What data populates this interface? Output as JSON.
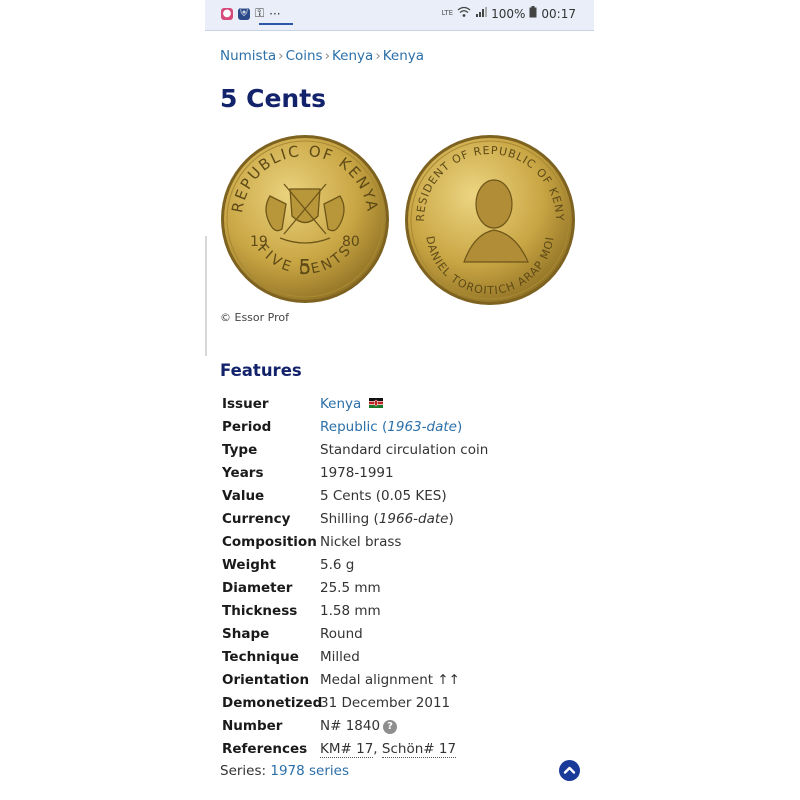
{
  "status_bar": {
    "time": "00:17",
    "battery": "100%",
    "network_label": "LTE",
    "more": "···"
  },
  "breadcrumb": [
    "Numista",
    "Coins",
    "Kenya",
    "Kenya"
  ],
  "breadcrumb_sep": "›",
  "title": "5 Cents",
  "image_credit": "© Essor Prof",
  "coin_obverse": {
    "legend_top": "REPUBLIC OF KENYA",
    "year_left": "19",
    "year_right": "80",
    "value": "5",
    "legend_bottom": "FIVE CENTS"
  },
  "coin_reverse": {
    "legend_top": "PRESIDENT OF REPUBLIC OF KENYA",
    "legend_bottom": "DANIEL TOROITICH ARAP MOI"
  },
  "features_heading": "Features",
  "features": {
    "issuer": {
      "label": "Issuer",
      "value": "Kenya"
    },
    "period": {
      "label": "Period",
      "value": "Republic",
      "paren_open": " (",
      "range": "1963-date",
      "paren_close": ")"
    },
    "type": {
      "label": "Type",
      "value": "Standard circulation coin"
    },
    "years": {
      "label": "Years",
      "value": "1978-1991"
    },
    "value": {
      "label": "Value",
      "value": "5 Cents (0.05 KES)"
    },
    "currency": {
      "label": "Currency",
      "value": "Shilling (",
      "range": "1966-date",
      "paren_close": ")"
    },
    "composition": {
      "label": "Composition",
      "value": "Nickel brass"
    },
    "weight": {
      "label": "Weight",
      "value": "5.6 g"
    },
    "diameter": {
      "label": "Diameter",
      "value": "25.5 mm"
    },
    "thickness": {
      "label": "Thickness",
      "value": "1.58 mm"
    },
    "shape": {
      "label": "Shape",
      "value": "Round"
    },
    "technique": {
      "label": "Technique",
      "value": "Milled"
    },
    "orientation": {
      "label": "Orientation",
      "value": "Medal alignment ↑↑"
    },
    "demonetized": {
      "label": "Demonetized",
      "value": "31 December 2011"
    },
    "number": {
      "label": "Number",
      "value": "N# 1840",
      "help": "?"
    },
    "references": {
      "label": "References",
      "ref1": "KM# 17",
      "sep": ", ",
      "ref2": "Schön# 17"
    }
  },
  "series": {
    "label": "Series: ",
    "value": "1978 series"
  },
  "scroll_top_icon": "^",
  "colors": {
    "accent_link": "#2c6fa8",
    "heading": "#12226b",
    "coin_gold": "#c8a441",
    "status_bg": "#e9eef8"
  }
}
